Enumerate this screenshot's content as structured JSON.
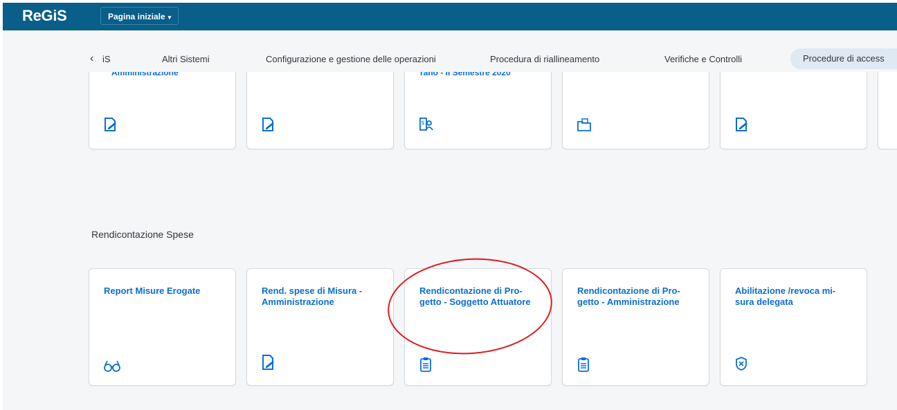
{
  "shellbar": {
    "logo": "ReGiS",
    "home_menu": "Pagina iniziale",
    "home_caret": "▾"
  },
  "tabs": {
    "scroll_left": "‹",
    "items": [
      "iS",
      "Altri Sistemi",
      "Configurazione e gestione delle operazioni",
      "Procedura di riallineamento",
      "Verifiche e Controlli",
      "Procedure di access"
    ]
  },
  "top_cards": [
    {
      "partial_title": "Amministrazione",
      "icon": "edit-document-icon"
    },
    {
      "partial_title": "",
      "icon": "edit-document-icon"
    },
    {
      "partial_title": "rano - II Semestre 2020",
      "icon": "payment-user-icon"
    },
    {
      "partial_title": "",
      "icon": "folder-photo-icon"
    },
    {
      "partial_title": "",
      "icon": "edit-document-icon"
    }
  ],
  "section": {
    "title": "Rendicontazione Spese",
    "cards": [
      {
        "title": "Report Misure Erogate",
        "icon": "glasses-icon"
      },
      {
        "title": "Rend. spese di Misura - Amministrazione",
        "icon": "edit-document-icon"
      },
      {
        "title": "Rendicontazione di Pro-getto - Soggetto Attuatore",
        "icon": "clipboard-icon"
      },
      {
        "title": "Rendicontazione di Pro-getto - Amministrazione",
        "icon": "clipboard-icon"
      },
      {
        "title": "Abilitazione /revoca mi-sura delegata",
        "icon": "shield-x-icon"
      }
    ]
  },
  "colors": {
    "shellbar": "#0a5e8a",
    "accent": "#0a6ed1",
    "annotation": "#e01717"
  }
}
